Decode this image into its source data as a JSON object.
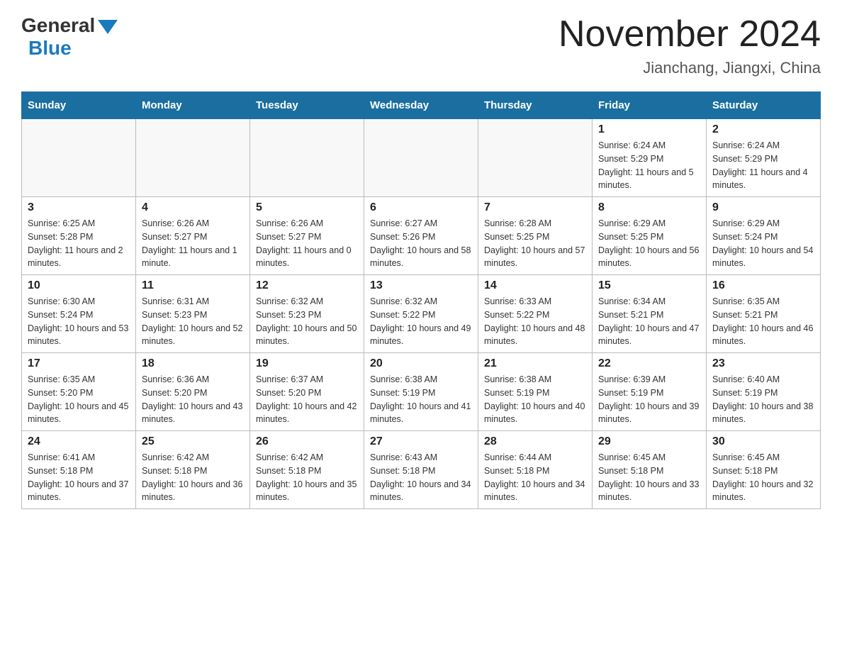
{
  "header": {
    "logo_general": "General",
    "logo_blue": "Blue",
    "month_title": "November 2024",
    "location": "Jianchang, Jiangxi, China"
  },
  "calendar": {
    "days_of_week": [
      "Sunday",
      "Monday",
      "Tuesday",
      "Wednesday",
      "Thursday",
      "Friday",
      "Saturday"
    ],
    "weeks": [
      [
        {
          "day": "",
          "detail": ""
        },
        {
          "day": "",
          "detail": ""
        },
        {
          "day": "",
          "detail": ""
        },
        {
          "day": "",
          "detail": ""
        },
        {
          "day": "",
          "detail": ""
        },
        {
          "day": "1",
          "detail": "Sunrise: 6:24 AM\nSunset: 5:29 PM\nDaylight: 11 hours and 5 minutes."
        },
        {
          "day": "2",
          "detail": "Sunrise: 6:24 AM\nSunset: 5:29 PM\nDaylight: 11 hours and 4 minutes."
        }
      ],
      [
        {
          "day": "3",
          "detail": "Sunrise: 6:25 AM\nSunset: 5:28 PM\nDaylight: 11 hours and 2 minutes."
        },
        {
          "day": "4",
          "detail": "Sunrise: 6:26 AM\nSunset: 5:27 PM\nDaylight: 11 hours and 1 minute."
        },
        {
          "day": "5",
          "detail": "Sunrise: 6:26 AM\nSunset: 5:27 PM\nDaylight: 11 hours and 0 minutes."
        },
        {
          "day": "6",
          "detail": "Sunrise: 6:27 AM\nSunset: 5:26 PM\nDaylight: 10 hours and 58 minutes."
        },
        {
          "day": "7",
          "detail": "Sunrise: 6:28 AM\nSunset: 5:25 PM\nDaylight: 10 hours and 57 minutes."
        },
        {
          "day": "8",
          "detail": "Sunrise: 6:29 AM\nSunset: 5:25 PM\nDaylight: 10 hours and 56 minutes."
        },
        {
          "day": "9",
          "detail": "Sunrise: 6:29 AM\nSunset: 5:24 PM\nDaylight: 10 hours and 54 minutes."
        }
      ],
      [
        {
          "day": "10",
          "detail": "Sunrise: 6:30 AM\nSunset: 5:24 PM\nDaylight: 10 hours and 53 minutes."
        },
        {
          "day": "11",
          "detail": "Sunrise: 6:31 AM\nSunset: 5:23 PM\nDaylight: 10 hours and 52 minutes."
        },
        {
          "day": "12",
          "detail": "Sunrise: 6:32 AM\nSunset: 5:23 PM\nDaylight: 10 hours and 50 minutes."
        },
        {
          "day": "13",
          "detail": "Sunrise: 6:32 AM\nSunset: 5:22 PM\nDaylight: 10 hours and 49 minutes."
        },
        {
          "day": "14",
          "detail": "Sunrise: 6:33 AM\nSunset: 5:22 PM\nDaylight: 10 hours and 48 minutes."
        },
        {
          "day": "15",
          "detail": "Sunrise: 6:34 AM\nSunset: 5:21 PM\nDaylight: 10 hours and 47 minutes."
        },
        {
          "day": "16",
          "detail": "Sunrise: 6:35 AM\nSunset: 5:21 PM\nDaylight: 10 hours and 46 minutes."
        }
      ],
      [
        {
          "day": "17",
          "detail": "Sunrise: 6:35 AM\nSunset: 5:20 PM\nDaylight: 10 hours and 45 minutes."
        },
        {
          "day": "18",
          "detail": "Sunrise: 6:36 AM\nSunset: 5:20 PM\nDaylight: 10 hours and 43 minutes."
        },
        {
          "day": "19",
          "detail": "Sunrise: 6:37 AM\nSunset: 5:20 PM\nDaylight: 10 hours and 42 minutes."
        },
        {
          "day": "20",
          "detail": "Sunrise: 6:38 AM\nSunset: 5:19 PM\nDaylight: 10 hours and 41 minutes."
        },
        {
          "day": "21",
          "detail": "Sunrise: 6:38 AM\nSunset: 5:19 PM\nDaylight: 10 hours and 40 minutes."
        },
        {
          "day": "22",
          "detail": "Sunrise: 6:39 AM\nSunset: 5:19 PM\nDaylight: 10 hours and 39 minutes."
        },
        {
          "day": "23",
          "detail": "Sunrise: 6:40 AM\nSunset: 5:19 PM\nDaylight: 10 hours and 38 minutes."
        }
      ],
      [
        {
          "day": "24",
          "detail": "Sunrise: 6:41 AM\nSunset: 5:18 PM\nDaylight: 10 hours and 37 minutes."
        },
        {
          "day": "25",
          "detail": "Sunrise: 6:42 AM\nSunset: 5:18 PM\nDaylight: 10 hours and 36 minutes."
        },
        {
          "day": "26",
          "detail": "Sunrise: 6:42 AM\nSunset: 5:18 PM\nDaylight: 10 hours and 35 minutes."
        },
        {
          "day": "27",
          "detail": "Sunrise: 6:43 AM\nSunset: 5:18 PM\nDaylight: 10 hours and 34 minutes."
        },
        {
          "day": "28",
          "detail": "Sunrise: 6:44 AM\nSunset: 5:18 PM\nDaylight: 10 hours and 34 minutes."
        },
        {
          "day": "29",
          "detail": "Sunrise: 6:45 AM\nSunset: 5:18 PM\nDaylight: 10 hours and 33 minutes."
        },
        {
          "day": "30",
          "detail": "Sunrise: 6:45 AM\nSunset: 5:18 PM\nDaylight: 10 hours and 32 minutes."
        }
      ]
    ]
  }
}
